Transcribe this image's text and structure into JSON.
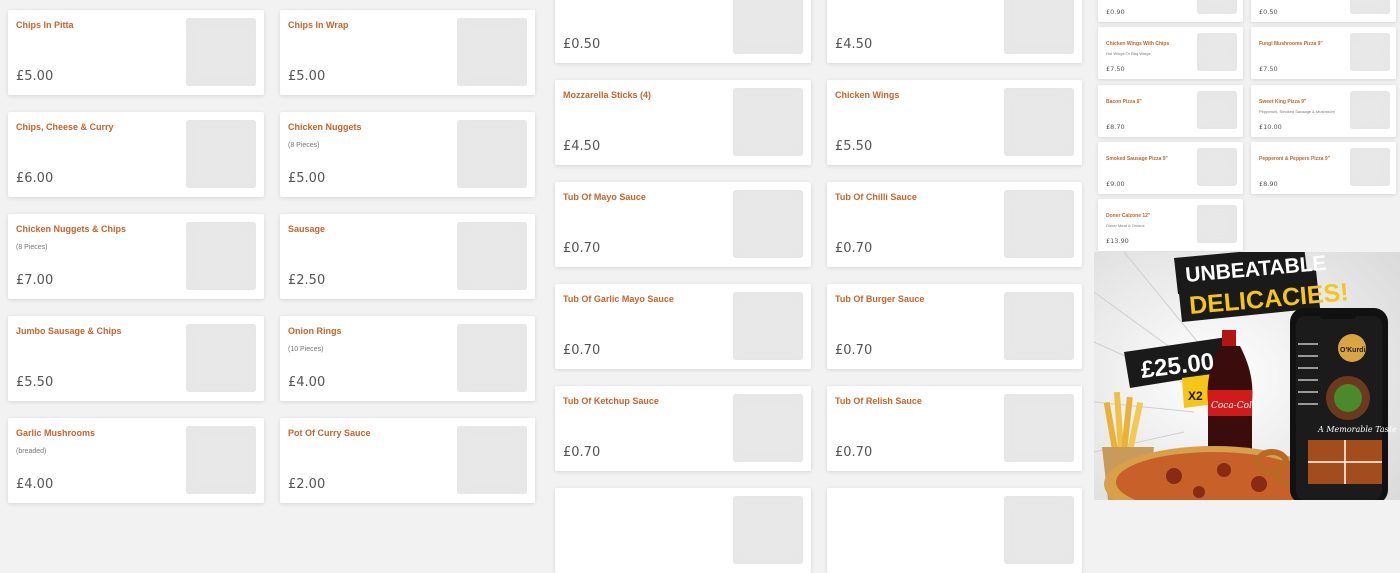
{
  "col1": [
    {
      "name": "Chips In Pitta",
      "desc": "",
      "price": "£5.00"
    },
    {
      "name": "Chips, Cheese & Curry",
      "desc": "",
      "price": "£6.00"
    },
    {
      "name": "Chicken Nuggets & Chips",
      "desc": "(8 Pieces)",
      "price": "£7.00"
    },
    {
      "name": "Jumbo Sausage & Chips",
      "desc": "",
      "price": "£5.50"
    },
    {
      "name": "Garlic Mushrooms",
      "desc": "(breaded)",
      "price": "£4.00"
    }
  ],
  "col2": [
    {
      "name": "Chips In Wrap",
      "desc": "",
      "price": "£5.00"
    },
    {
      "name": "Chicken Nuggets",
      "desc": "(8 Pieces)",
      "price": "£5.00"
    },
    {
      "name": "Sausage",
      "desc": "",
      "price": "£2.50"
    },
    {
      "name": "Onion Rings",
      "desc": "(10 Pieces)",
      "price": "£4.00"
    },
    {
      "name": "Pot Of Curry Sauce",
      "desc": "",
      "price": "£2.00"
    }
  ],
  "col3": [
    {
      "name": "",
      "desc": "",
      "price": "£0.50"
    },
    {
      "name": "Mozzarella Sticks (4)",
      "desc": "",
      "price": "£4.50"
    },
    {
      "name": "Tub Of Mayo Sauce",
      "desc": "",
      "price": "£0.70"
    },
    {
      "name": "Tub Of Garlic Mayo Sauce",
      "desc": "",
      "price": "£0.70"
    },
    {
      "name": "Tub Of Ketchup Sauce",
      "desc": "",
      "price": "£0.70"
    }
  ],
  "col4": [
    {
      "name": "",
      "desc": "",
      "price": "£4.50"
    },
    {
      "name": "Chicken Wings",
      "desc": "",
      "price": "£5.50"
    },
    {
      "name": "Tub Of Chilli Sauce",
      "desc": "",
      "price": "£0.70"
    },
    {
      "name": "Tub Of Burger Sauce",
      "desc": "",
      "price": "£0.70"
    },
    {
      "name": "Tub Of Relish Sauce",
      "desc": "",
      "price": "£0.70"
    }
  ],
  "small_left": [
    {
      "name": "",
      "desc": "",
      "price": "£0.90"
    },
    {
      "name": "Chicken Wings With Chips",
      "desc": "Hot Wings Or Bbq Wings",
      "price": "£7.50"
    },
    {
      "name": "Bacon Pizza 9\"",
      "desc": "",
      "price": "£8.70"
    },
    {
      "name": "Smoked Sausage Pizza 9\"",
      "desc": "",
      "price": "£9.00"
    },
    {
      "name": "Doner Calzone 12\"",
      "desc": "Doner Meat & Onions",
      "price": "£13.90"
    }
  ],
  "small_right": [
    {
      "name": "",
      "desc": "",
      "price": "£0.50"
    },
    {
      "name": "Fungi Mushrooms Pizza 9\"",
      "desc": "",
      "price": "£7.50"
    },
    {
      "name": "Sweet King Pizza 9\"",
      "desc": "Pepperoni, Smoked Sausage & Mushroom",
      "price": "£10.00"
    },
    {
      "name": "Pepperoni & Peppers Pizza 9\"",
      "desc": "",
      "price": "£8.90"
    }
  ],
  "promo": {
    "headline1": "UNBEATABLE",
    "headline2": "DELICACIES!",
    "price": "£25.00",
    "multiplier": "X2",
    "cola": "Coca-Cola",
    "app_brand": "O'Kurdi",
    "app_tagline": "A Memorable Taste",
    "accent": "#f5c518"
  }
}
